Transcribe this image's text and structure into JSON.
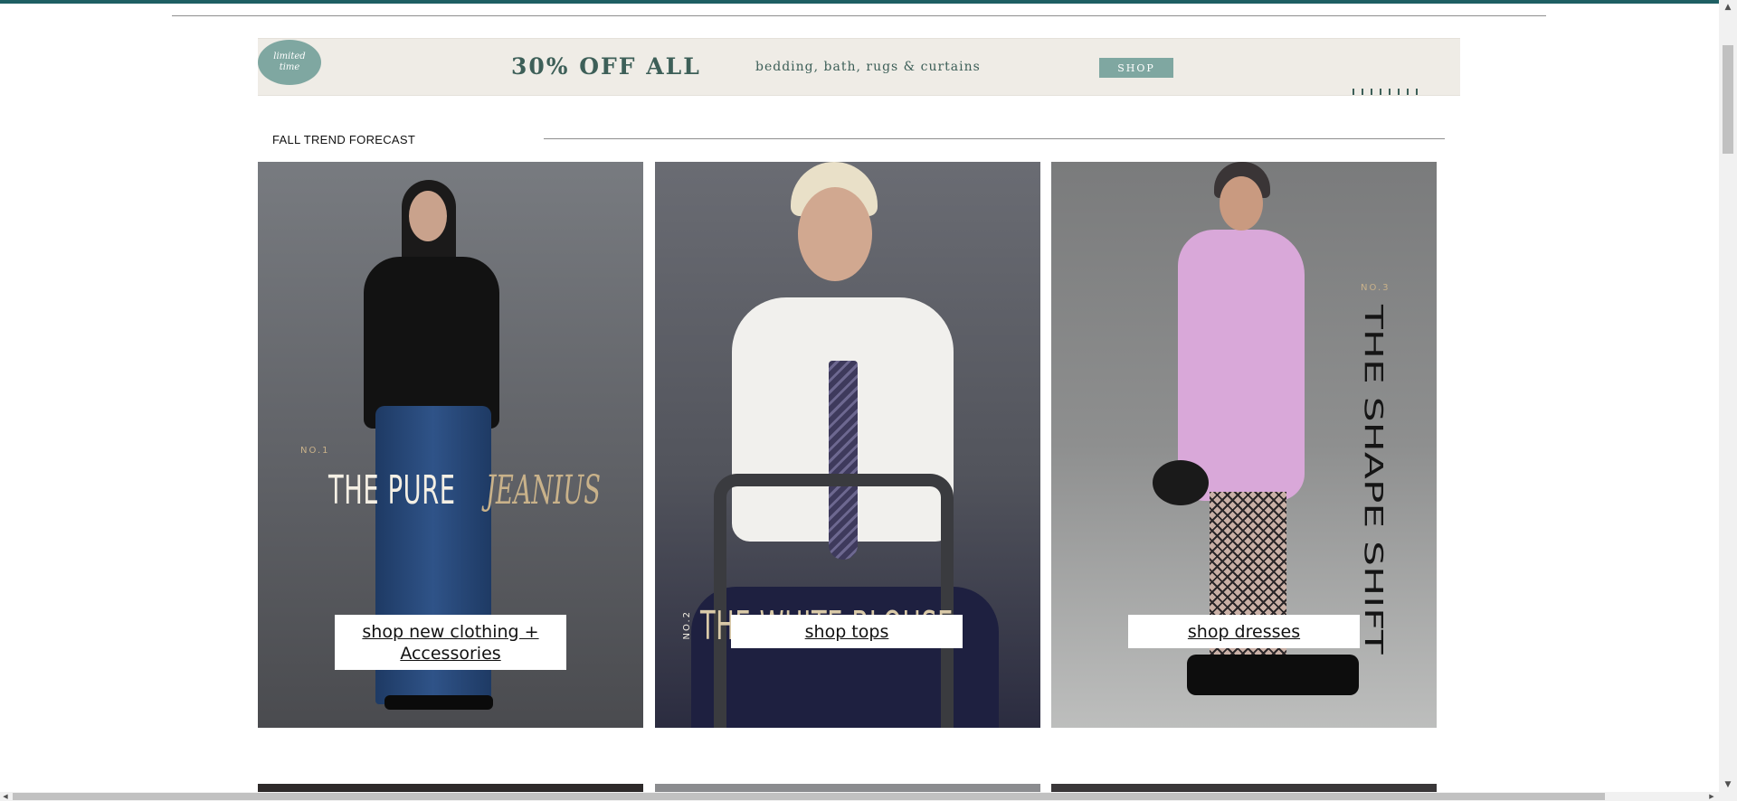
{
  "promo": {
    "badge_line1": "limited",
    "badge_line2": "time",
    "headline": "30% OFF ALL",
    "subtext": "bedding, bath, rugs & curtains",
    "cta": "SHOP"
  },
  "section": {
    "title": "FALL TREND FORECAST"
  },
  "cards": [
    {
      "number": "NO.1",
      "title": "THE PURE",
      "accent": "JEANIUS",
      "cta": "shop new clothing + Accessories"
    },
    {
      "number": "NO.2",
      "title": "THE WHITE BLOUSE",
      "cta": "shop tops"
    },
    {
      "number": "NO.3",
      "title": "THE SHAPE SHIFT",
      "cta": "shop dresses"
    }
  ],
  "scrollbar": {
    "up_icon": "▲",
    "down_icon": "▼",
    "left_icon": "◀",
    "right_icon": "▶"
  }
}
